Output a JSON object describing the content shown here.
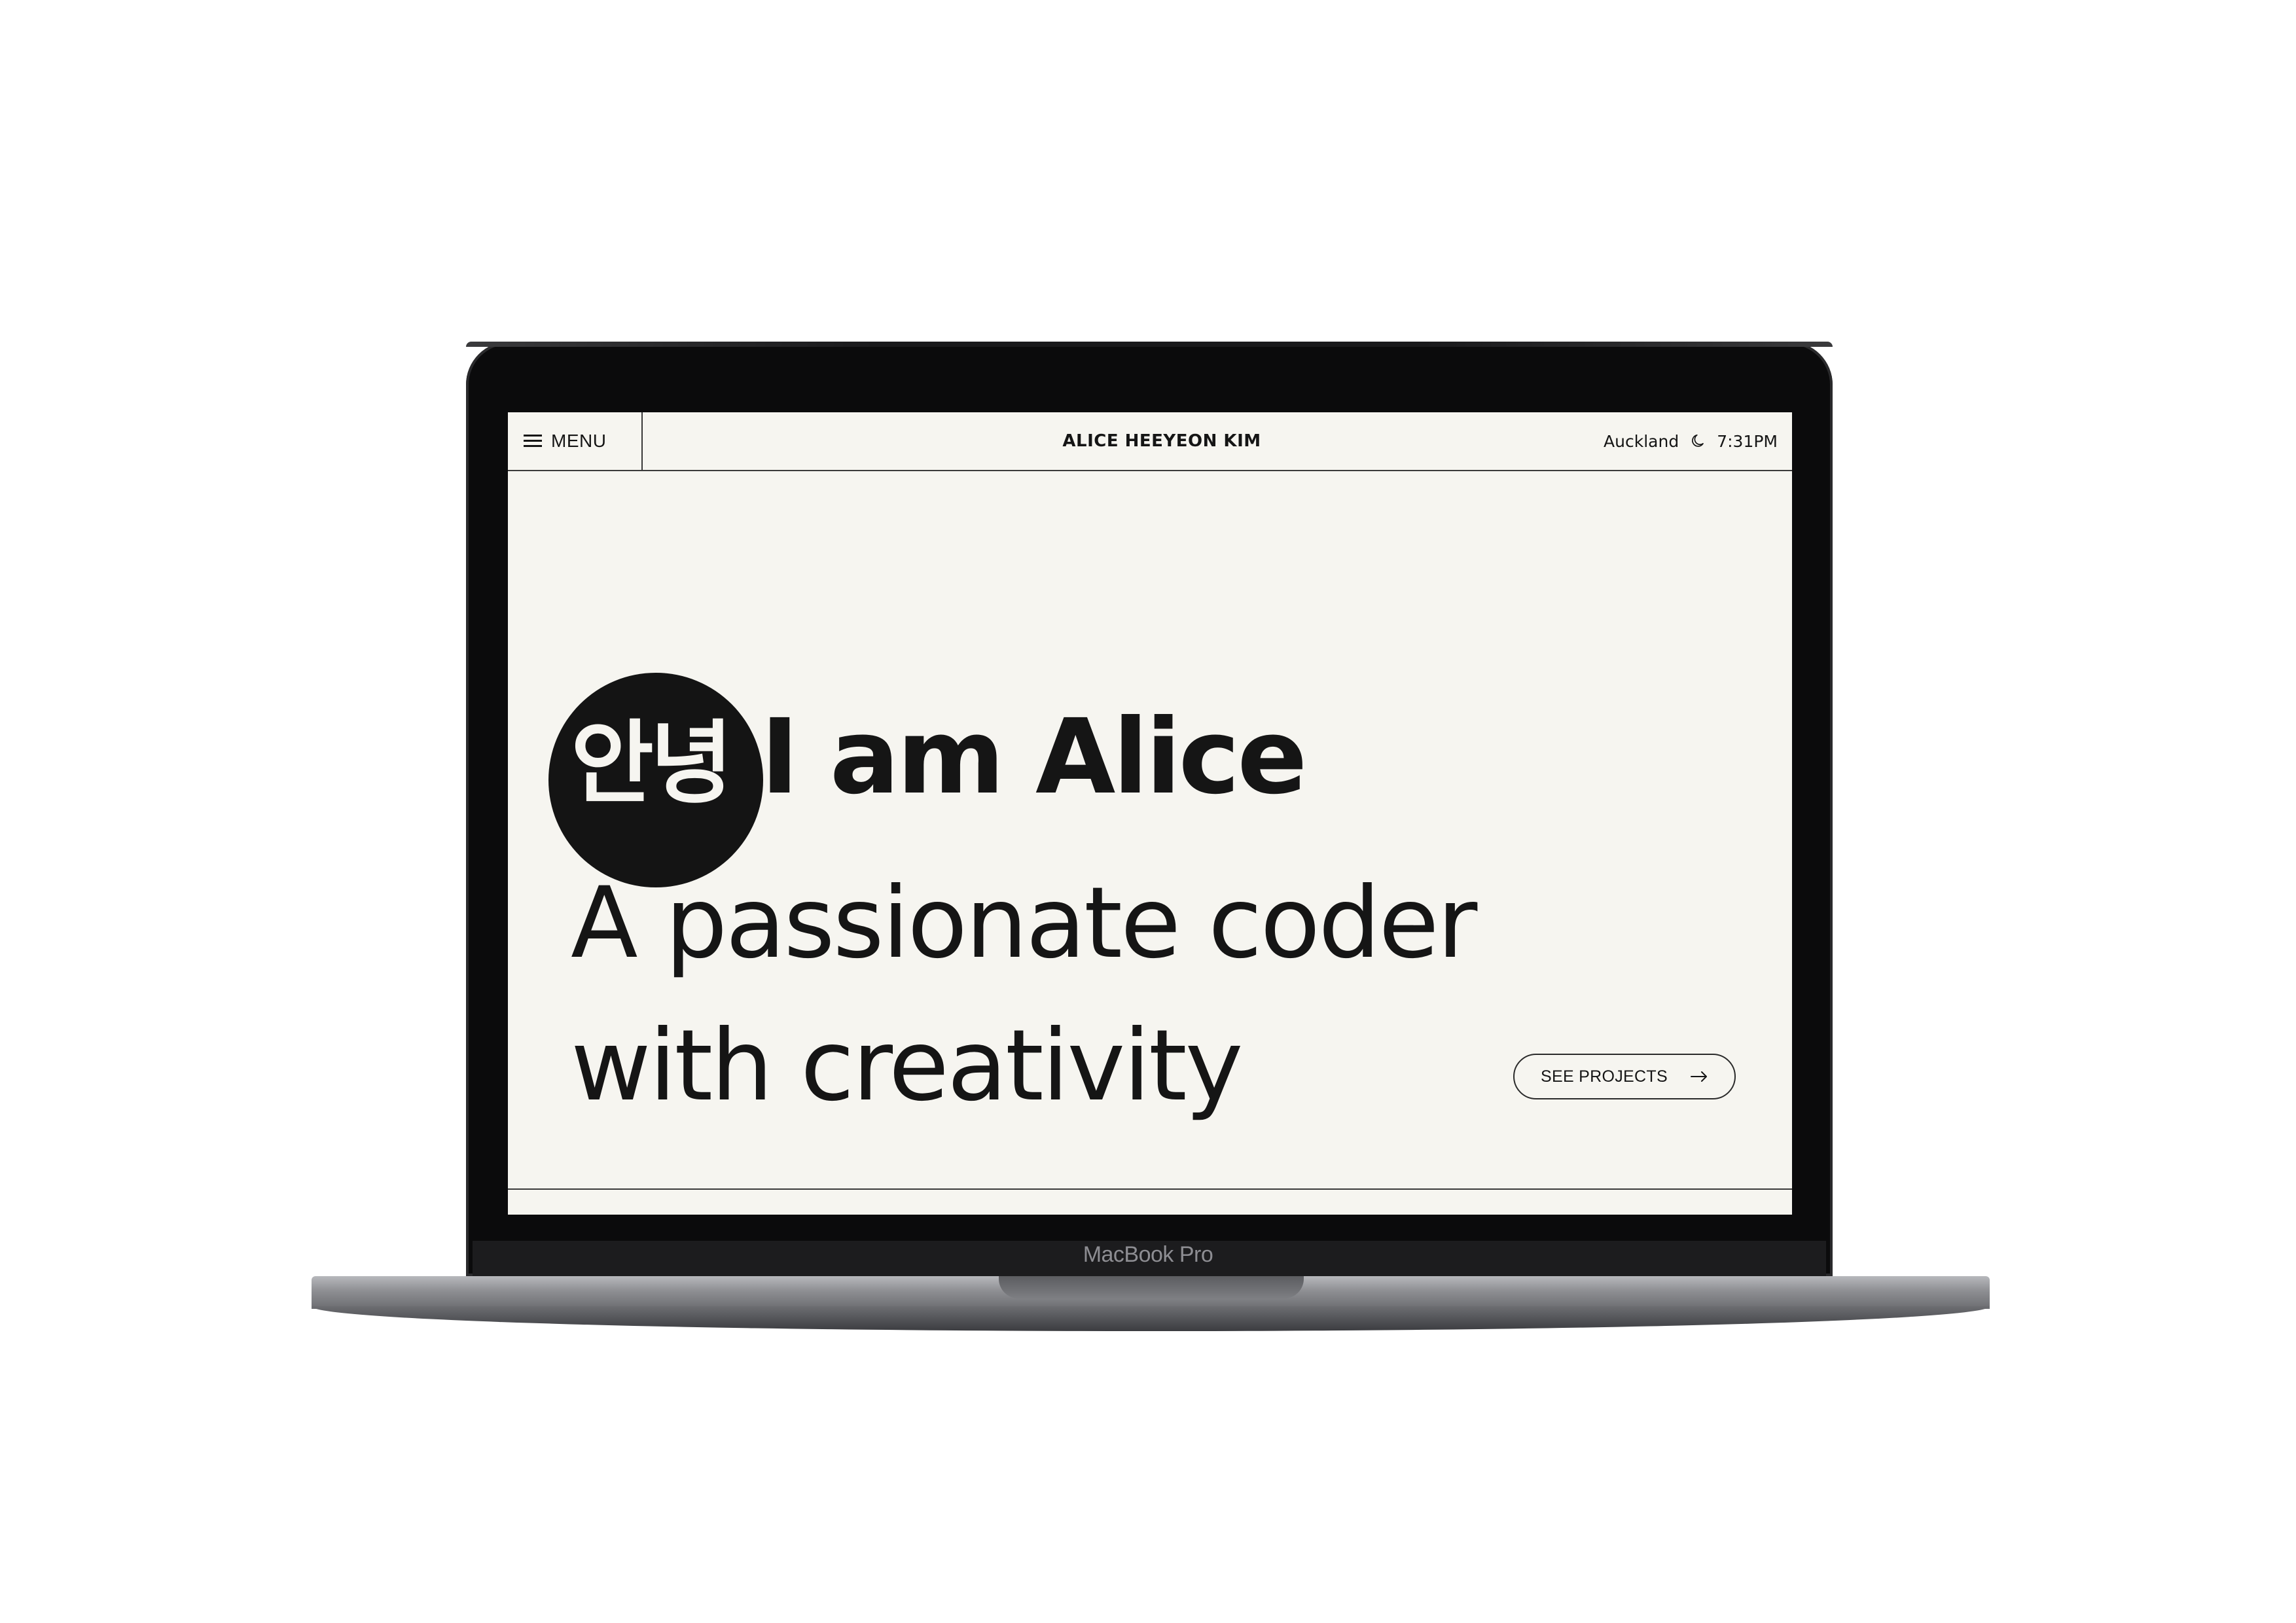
{
  "device": {
    "label": "MacBook Pro"
  },
  "nav": {
    "menu_label": "MENU",
    "brand": "ALICE HEEYEON KIM",
    "city": "Auckland",
    "time": "7:31PM",
    "icons": [
      "hamburger-icon",
      "moon-icon"
    ]
  },
  "hero": {
    "greeting_korean": "안녕",
    "line1": "I am Alice",
    "line2": "A passionate coder",
    "line3": "with creativity"
  },
  "cta": {
    "label": "SEE PROJECTS",
    "icon": "arrow-right-icon"
  },
  "colors": {
    "background": "#f6f5f0",
    "ink": "#151515",
    "bezel": "#0b0b0c"
  }
}
